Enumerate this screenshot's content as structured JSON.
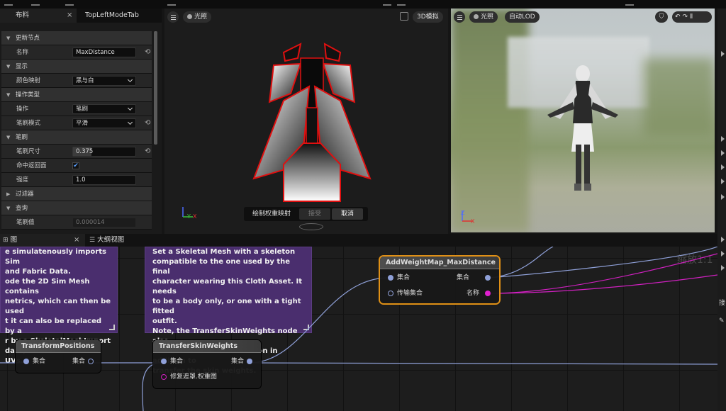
{
  "details": {
    "tabs": [
      "布料",
      "TopLeftModeTab"
    ],
    "rows": [
      {
        "type": "cat",
        "label": "更新节点"
      },
      {
        "type": "prop",
        "label": "名称",
        "value": "MaxDistance",
        "reset": "⟲"
      },
      {
        "type": "cat",
        "label": "显示"
      },
      {
        "type": "prop",
        "label": "颜色映射",
        "value": "黑与白"
      },
      {
        "type": "cat",
        "label": "操作类型"
      },
      {
        "type": "prop",
        "label": "操作",
        "value": "笔刷"
      },
      {
        "type": "prop",
        "label": "笔刷模式",
        "value": "平滑",
        "reset": "⟲"
      },
      {
        "type": "cat",
        "label": "笔刷"
      },
      {
        "type": "prop",
        "label": "笔刷尺寸",
        "value": "0.375",
        "reset": "⟲"
      },
      {
        "type": "prop",
        "label": "命中返回面",
        "value": "✔"
      },
      {
        "type": "prop",
        "label": "强度",
        "value": "1.0"
      },
      {
        "type": "cat",
        "label": "过滤器"
      },
      {
        "type": "cat",
        "label": "查询"
      },
      {
        "type": "prop",
        "label": "笔刷值",
        "value": "0.000014"
      }
    ]
  },
  "viewport_left": {
    "lighting": "光照",
    "view_mode": "3D模拟",
    "paint_prompt": "绘制权重映射",
    "accept": "接受",
    "cancel": "取消",
    "axis_y": "Y",
    "axis_x": "X"
  },
  "viewport_right": {
    "lighting": "光照",
    "lod": "自动LOD",
    "axis_z": "Z",
    "axis_x": "X"
  },
  "graph_tabs": {
    "graph": "图",
    "outline": "大纲视图"
  },
  "graph": {
    "zoom": "缩放1:1",
    "comment1": [
      "e simulatenously imports Sim",
      "and Fabric Data.",
      "ode the 2D Sim Mesh contains",
      "netrics, which can then be used",
      "t it can also be replaced by a",
      "r by a SkeletalMeshImport",
      "data, and with unified UVs."
    ],
    "comment2": [
      "Set a Skeletal Mesh with a skeleton",
      "compatible to the one used by the final",
      "character wearing this Cloth Asset. It needs",
      "to be a body only, or one with a tight fitted",
      "outfit.",
      "Note, the TransferSkinWeights node also",
      "sets the cloth asset skeleton in addition to",
      "transfer the skin weights."
    ],
    "node_transform": {
      "title": "TransformPositions",
      "in": "集合",
      "out": "集合"
    },
    "node_transfer": {
      "title": "TransferSkinWeights",
      "in": "集合",
      "out": "集合",
      "in2": "修复遮罩.权重图"
    },
    "node_addweight": {
      "title": "AddWeightMap_MaxDistance",
      "in": "集合",
      "in2": "传输集合",
      "out": "集合",
      "out2": "名称"
    }
  },
  "right_edge_label": "接"
}
